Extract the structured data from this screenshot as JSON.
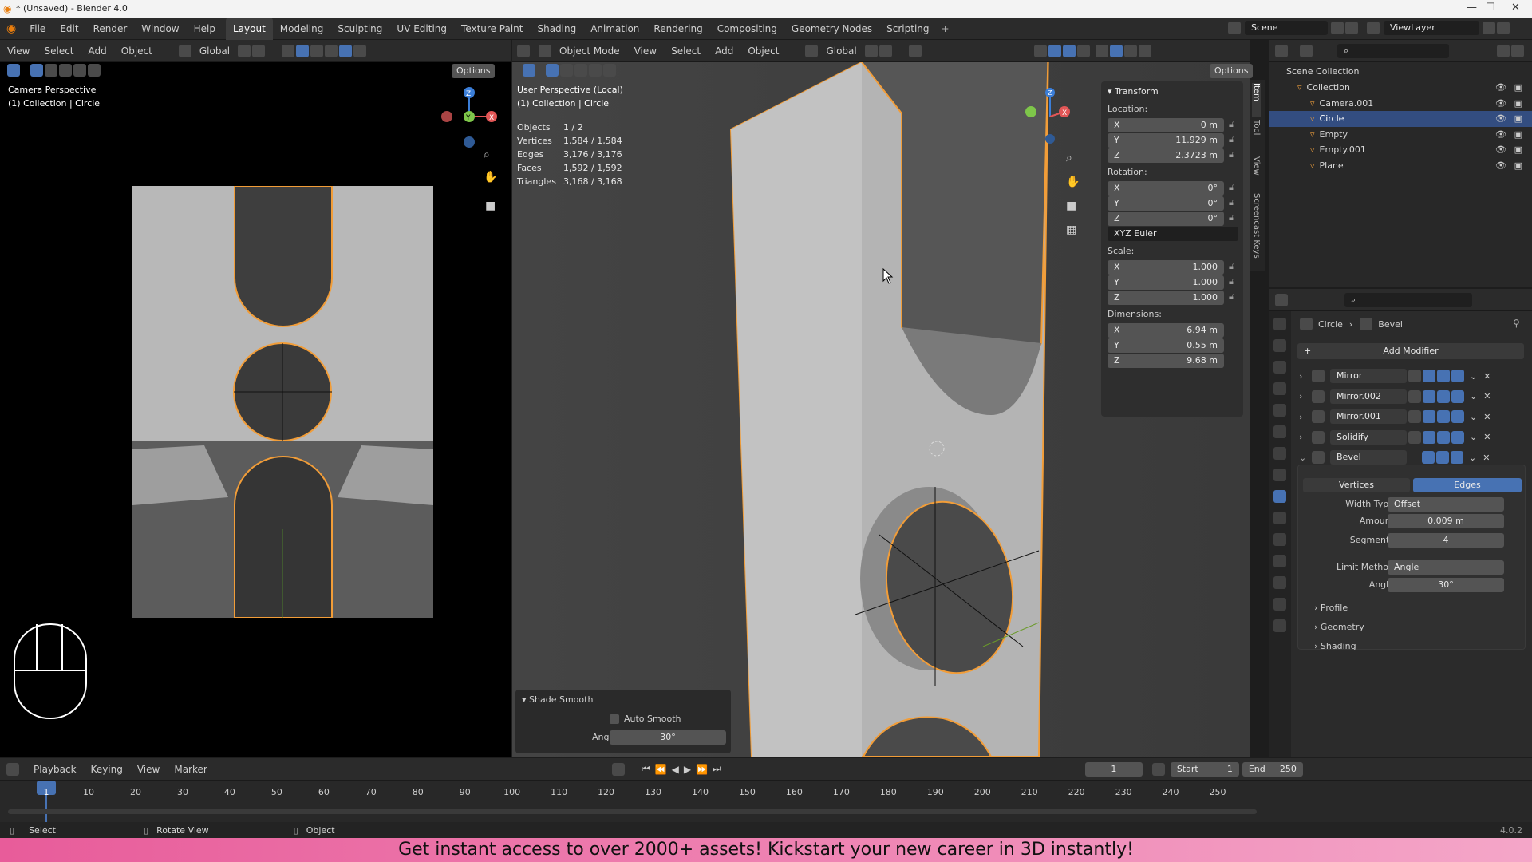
{
  "title": "* (Unsaved) - Blender 4.0",
  "menus": [
    "File",
    "Edit",
    "Render",
    "Window",
    "Help"
  ],
  "workspaces": [
    "Layout",
    "Modeling",
    "Sculpting",
    "UV Editing",
    "Texture Paint",
    "Shading",
    "Animation",
    "Rendering",
    "Compositing",
    "Geometry Nodes",
    "Scripting"
  ],
  "active_workspace": "Layout",
  "scene": "Scene",
  "view_layer": "ViewLayer",
  "left_view": {
    "menus": [
      "View",
      "Select",
      "Add",
      "Object"
    ],
    "orientation": "Global",
    "options": "Options",
    "label1": "Camera Perspective",
    "label2": "(1) Collection | Circle"
  },
  "main_view": {
    "mode": "Object Mode",
    "menus": [
      "View",
      "Select",
      "Add",
      "Object"
    ],
    "orientation": "Global",
    "options": "Options",
    "label1": "User Perspective (Local)",
    "label2": "(1) Collection | Circle",
    "stats": [
      {
        "k": "Objects",
        "v": "1 / 2"
      },
      {
        "k": "Vertices",
        "v": "1,584 / 1,584"
      },
      {
        "k": "Edges",
        "v": "3,176 / 3,176"
      },
      {
        "k": "Faces",
        "v": "1,592 / 1,592"
      },
      {
        "k": "Triangles",
        "v": "3,168 / 3,168"
      }
    ]
  },
  "transform": {
    "title": "Transform",
    "location_label": "Location:",
    "location": [
      {
        "a": "X",
        "v": "0 m"
      },
      {
        "a": "Y",
        "v": "11.929 m"
      },
      {
        "a": "Z",
        "v": "2.3723 m"
      }
    ],
    "rotation_label": "Rotation:",
    "rotation": [
      {
        "a": "X",
        "v": "0°"
      },
      {
        "a": "Y",
        "v": "0°"
      },
      {
        "a": "Z",
        "v": "0°"
      }
    ],
    "rotation_mode": "XYZ Euler",
    "scale_label": "Scale:",
    "scale": [
      {
        "a": "X",
        "v": "1.000"
      },
      {
        "a": "Y",
        "v": "1.000"
      },
      {
        "a": "Z",
        "v": "1.000"
      }
    ],
    "dimensions_label": "Dimensions:",
    "dimensions": [
      {
        "a": "X",
        "v": "6.94 m"
      },
      {
        "a": "Y",
        "v": "0.55 m"
      },
      {
        "a": "Z",
        "v": "9.68 m"
      }
    ]
  },
  "side_tabs": [
    "Item",
    "Tool",
    "View",
    "Screencast Keys"
  ],
  "shade_smooth": {
    "title": "Shade Smooth",
    "auto_smooth": "Auto Smooth",
    "angle_label": "Angle",
    "angle": "30°"
  },
  "outliner": {
    "root": "Scene Collection",
    "items": [
      {
        "name": "Collection",
        "indent": 1
      },
      {
        "name": "Camera.001",
        "indent": 2
      },
      {
        "name": "Circle",
        "indent": 2,
        "selected": true
      },
      {
        "name": "Empty",
        "indent": 2
      },
      {
        "name": "Empty.001",
        "indent": 2
      },
      {
        "name": "Plane",
        "indent": 2
      }
    ]
  },
  "properties": {
    "breadcrumb_object": "Circle",
    "breadcrumb_modifier": "Bevel",
    "add_modifier": "Add Modifier",
    "modifiers": [
      "Mirror",
      "Mirror.002",
      "Mirror.001",
      "Solidify",
      "Bevel"
    ],
    "bevel": {
      "tab_vertices": "Vertices",
      "tab_edges": "Edges",
      "width_type_label": "Width Type",
      "width_type": "Offset",
      "amount_label": "Amount",
      "amount": "0.009 m",
      "segments_label": "Segments",
      "segments": "4",
      "limit_method_label": "Limit Method",
      "limit_method": "Angle",
      "angle_label": "Angle",
      "angle": "30°",
      "subpanels": [
        "Profile",
        "Geometry",
        "Shading"
      ]
    }
  },
  "timeline": {
    "menus": [
      "Playback",
      "Keying",
      "View",
      "Marker"
    ],
    "current_frame": "1",
    "start_label": "Start",
    "start": "1",
    "end_label": "End",
    "end": "250",
    "ticks": [
      "1",
      "10",
      "20",
      "30",
      "40",
      "50",
      "60",
      "70",
      "80",
      "90",
      "100",
      "110",
      "120",
      "130",
      "140",
      "150",
      "160",
      "170",
      "180",
      "190",
      "200",
      "210",
      "220",
      "230",
      "240",
      "250"
    ]
  },
  "statusbar": {
    "select": "Select",
    "rotate": "Rotate View",
    "object": "Object",
    "version": "4.0.2"
  },
  "banner": "Get instant access to over 2000+ assets! Kickstart your new career in 3D instantly!",
  "colors": {
    "accent": "#4772b3",
    "outline": "#f29d38",
    "banner_left": "#e85c9a",
    "banner_right": "#f4a6c8"
  }
}
